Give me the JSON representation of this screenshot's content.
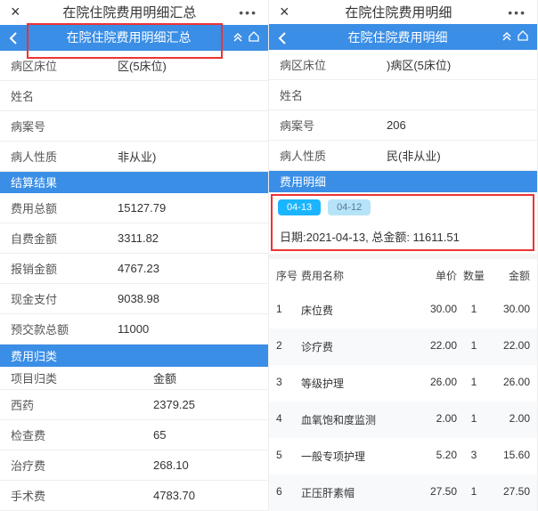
{
  "left": {
    "titlebar": "在院住院费用明细汇总",
    "nav_title": "在院住院费用明细汇总",
    "info": [
      {
        "lbl": "病区床位",
        "val": "区(5床位)"
      },
      {
        "lbl": "姓名",
        "val": ""
      },
      {
        "lbl": "病案号",
        "val": ""
      },
      {
        "lbl": "病人性质",
        "val": "非从业)"
      }
    ],
    "section1": "结算结果",
    "settle": [
      {
        "lbl": "费用总额",
        "val": "15127.79"
      },
      {
        "lbl": "自费金额",
        "val": "3311.82"
      },
      {
        "lbl": "报销金额",
        "val": "4767.23"
      },
      {
        "lbl": "现金支付",
        "val": "9038.98"
      },
      {
        "lbl": "预交款总额",
        "val": "11000"
      }
    ],
    "section2": "费用归类",
    "cat_hdr": {
      "lbl": "项目归类",
      "val": "金额"
    },
    "cats": [
      {
        "lbl": "西药",
        "val": "2379.25"
      },
      {
        "lbl": "检查费",
        "val": "65"
      },
      {
        "lbl": "治疗费",
        "val": "268.10"
      },
      {
        "lbl": "手术费",
        "val": "4783.70"
      }
    ]
  },
  "right": {
    "titlebar": "在院住院费用明细",
    "nav_title": "在院住院费用明细",
    "info": [
      {
        "lbl": "病区床位",
        "val": ")病区(5床位)"
      },
      {
        "lbl": "姓名",
        "val": ""
      },
      {
        "lbl": "病案号",
        "val": "206"
      },
      {
        "lbl": "病人性质",
        "val": "民(非从业)"
      }
    ],
    "section": "费用明细",
    "tabs": [
      "04-13",
      "04-12"
    ],
    "summary": "日期:2021-04-13, 总金额: 11611.51",
    "thdr": {
      "idx": "序号",
      "name": "费用名称",
      "price": "单价",
      "qty": "数量",
      "amt": "金额"
    },
    "rows": [
      {
        "idx": "1",
        "name": "床位费",
        "price": "30.00",
        "qty": "1",
        "amt": "30.00"
      },
      {
        "idx": "2",
        "name": "诊疗费",
        "price": "22.00",
        "qty": "1",
        "amt": "22.00"
      },
      {
        "idx": "3",
        "name": "等级护理",
        "price": "26.00",
        "qty": "1",
        "amt": "26.00"
      },
      {
        "idx": "4",
        "name": "血氧饱和度监测",
        "price": "2.00",
        "qty": "1",
        "amt": "2.00"
      },
      {
        "idx": "5",
        "name": "一般专项护理",
        "price": "5.20",
        "qty": "3",
        "amt": "15.60"
      },
      {
        "idx": "6",
        "name": "正压肝素帽",
        "price": "27.50",
        "qty": "1",
        "amt": "27.50"
      }
    ]
  }
}
